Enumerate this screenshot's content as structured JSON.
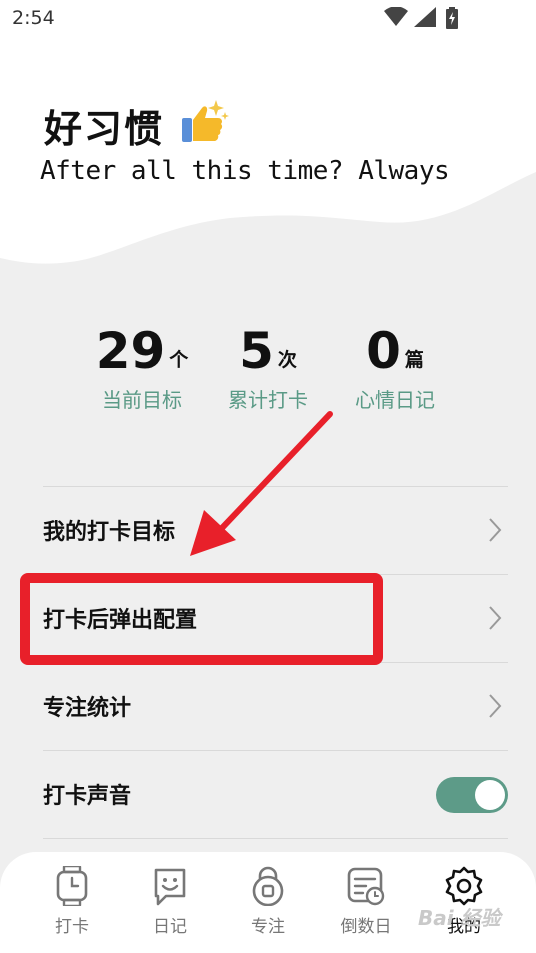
{
  "status_bar": {
    "time": "2:54"
  },
  "header": {
    "title": "好习惯",
    "subtitle": "After all this time? Always",
    "colors": {
      "accent": "#5d9b88",
      "highlight": "#e8202a"
    }
  },
  "stats": [
    {
      "value": "29",
      "unit": "个",
      "label": "当前目标"
    },
    {
      "value": "5",
      "unit": "次",
      "label": "累计打卡"
    },
    {
      "value": "0",
      "unit": "篇",
      "label": "心情日记"
    }
  ],
  "menu": [
    {
      "label": "我的打卡目标",
      "control": "chevron"
    },
    {
      "label": "打卡后弹出配置",
      "control": "chevron"
    },
    {
      "label": "专注统计",
      "control": "chevron"
    },
    {
      "label": "打卡声音",
      "control": "toggle",
      "toggle_on": true
    }
  ],
  "tab_bar": {
    "tabs": [
      {
        "label": "打卡",
        "icon": "watch-icon"
      },
      {
        "label": "日记",
        "icon": "smile-note-icon"
      },
      {
        "label": "专注",
        "icon": "lock-timer-icon"
      },
      {
        "label": "倒数日",
        "icon": "calendar-icon"
      },
      {
        "label": "我的",
        "icon": "gear-icon",
        "active": true
      }
    ]
  },
  "watermark": {
    "text": "Bai 经验"
  }
}
